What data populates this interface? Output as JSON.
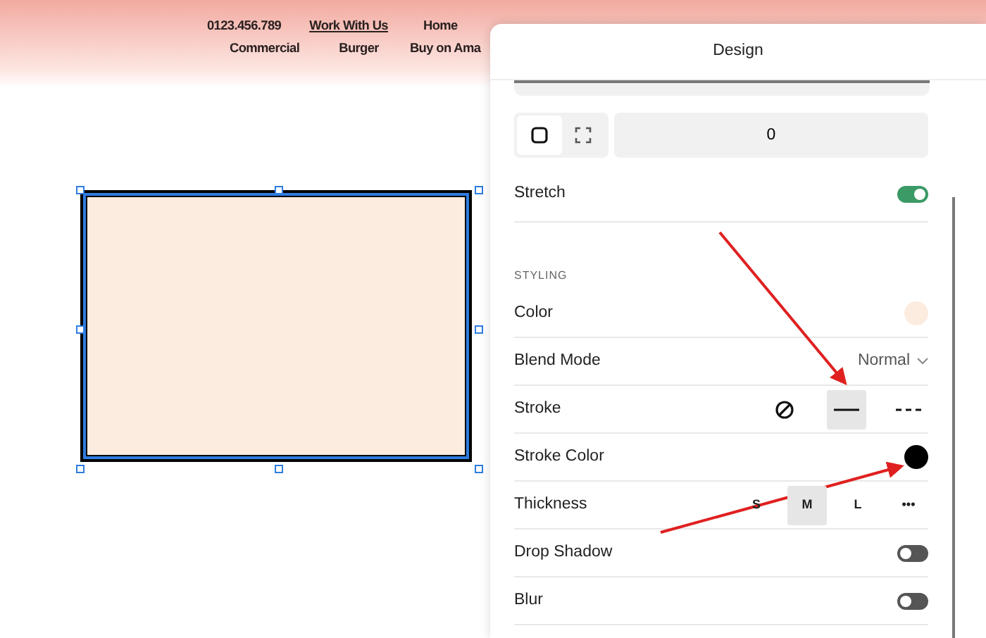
{
  "site_nav": {
    "rows": [
      [
        {
          "label": "0123.456.789",
          "selected": false
        },
        {
          "label": "Work With Us",
          "selected": true
        },
        {
          "label": "Home",
          "selected": false
        }
      ],
      [
        {
          "label": "Commercial",
          "selected": false
        },
        {
          "label": "Burger",
          "selected": false
        },
        {
          "label": "Buy on Ama",
          "selected": false
        }
      ]
    ]
  },
  "canvas": {
    "shape": {
      "selected": true
    }
  },
  "panel": {
    "title": "Design",
    "corner_modes": [
      {
        "kind": "rounded",
        "selected": true
      },
      {
        "kind": "corners",
        "selected": false
      }
    ],
    "radius_value": "0",
    "stretch": {
      "label": "Stretch",
      "on": true
    },
    "section": "STYLING",
    "rows": [
      {
        "kind": "swatch",
        "label": "Color",
        "color": "#fcebdf"
      },
      {
        "kind": "select",
        "label": "Blend Mode",
        "value": "Normal"
      },
      {
        "kind": "icons",
        "label": "Stroke",
        "options": [
          {
            "kind": "none",
            "selected": false
          },
          {
            "kind": "solid",
            "selected": true
          },
          {
            "kind": "dashed",
            "selected": false
          }
        ]
      },
      {
        "kind": "swatch",
        "label": "Stroke Color",
        "color": "#000000"
      },
      {
        "kind": "segments",
        "label": "Thickness",
        "options": [
          {
            "label": "S",
            "selected": false
          },
          {
            "label": "M",
            "selected": true
          },
          {
            "label": "L",
            "selected": false
          },
          {
            "label": "•••",
            "selected": false
          }
        ]
      },
      {
        "kind": "toggle",
        "label": "Drop Shadow",
        "on": false
      },
      {
        "kind": "toggle",
        "label": "Blur",
        "on": false
      }
    ]
  }
}
